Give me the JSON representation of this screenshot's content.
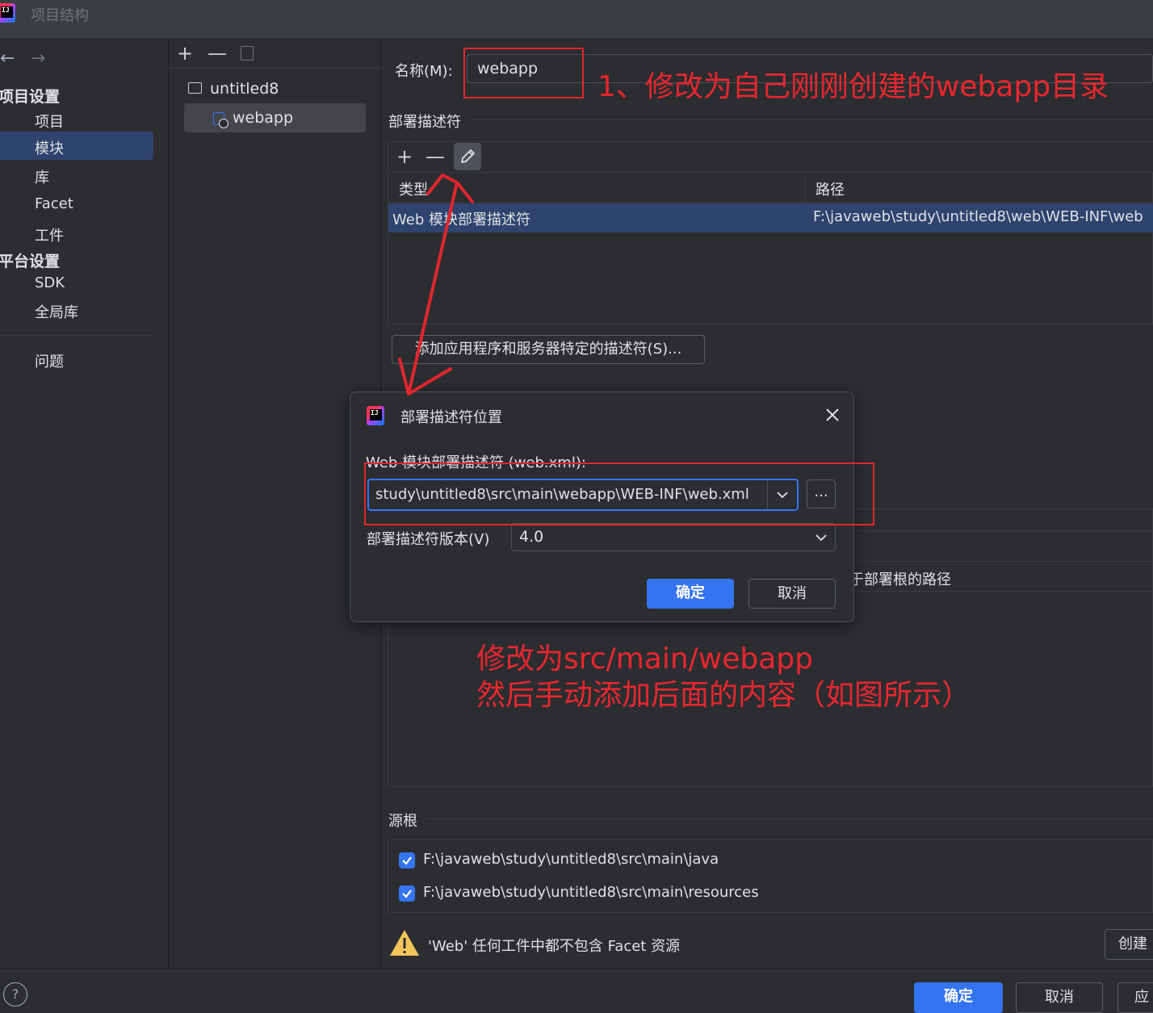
{
  "window": {
    "title": "项目结构"
  },
  "sidebar": {
    "project_settings_header": "项目设置",
    "project_items": [
      "项目",
      "模块",
      "库",
      "Facet",
      "工件"
    ],
    "platform_settings_header": "平台设置",
    "platform_items": [
      "SDK",
      "全局库"
    ],
    "problems": "问题"
  },
  "tree": {
    "nodes": [
      "untitled8",
      "webapp"
    ]
  },
  "main": {
    "name_label": "名称(M):",
    "name_value": "webapp",
    "descriptors_title": "部署描述符",
    "table": {
      "col_type": "类型",
      "col_path": "路径",
      "row_type": "Web 模块部署描述符",
      "row_path": "F:\\javaweb\\study\\untitled8\\web\\WEB-INF\\web"
    },
    "add_server_descriptor_button": "添加应用程序和服务器特定的描述符(S)...",
    "partial_header": "于部署根的路径",
    "source_roots_title": "源根",
    "source_roots": [
      "F:\\javaweb\\study\\untitled8\\src\\main\\java",
      "F:\\javaweb\\study\\untitled8\\src\\main\\resources"
    ],
    "warning_text": "'Web' 任何工件中都不包含 Facet 资源",
    "create_button": "创建"
  },
  "dialog": {
    "title": "部署描述符位置",
    "field_label": "Web 模块部署描述符 (web.xml):",
    "path_value": "study\\untitled8\\src\\main\\webapp\\WEB-INF\\web.xml",
    "browse_button": "...",
    "version_label": "部署描述符版本(V)",
    "version_value": "4.0",
    "ok_button": "确定",
    "cancel_button": "取消"
  },
  "annotations": {
    "note1": "1、修改为自己刚刚创建的webapp目录",
    "note2_line1": "修改为src/main/webapp",
    "note2_line2": "然后手动添加后面的内容（如图所示）"
  },
  "footer": {
    "ok": "确定",
    "cancel": "取消",
    "apply": "应"
  },
  "colors": {
    "accent": "#3574f0",
    "annotation_red": "#e0262e",
    "selection": "#2e436e"
  }
}
